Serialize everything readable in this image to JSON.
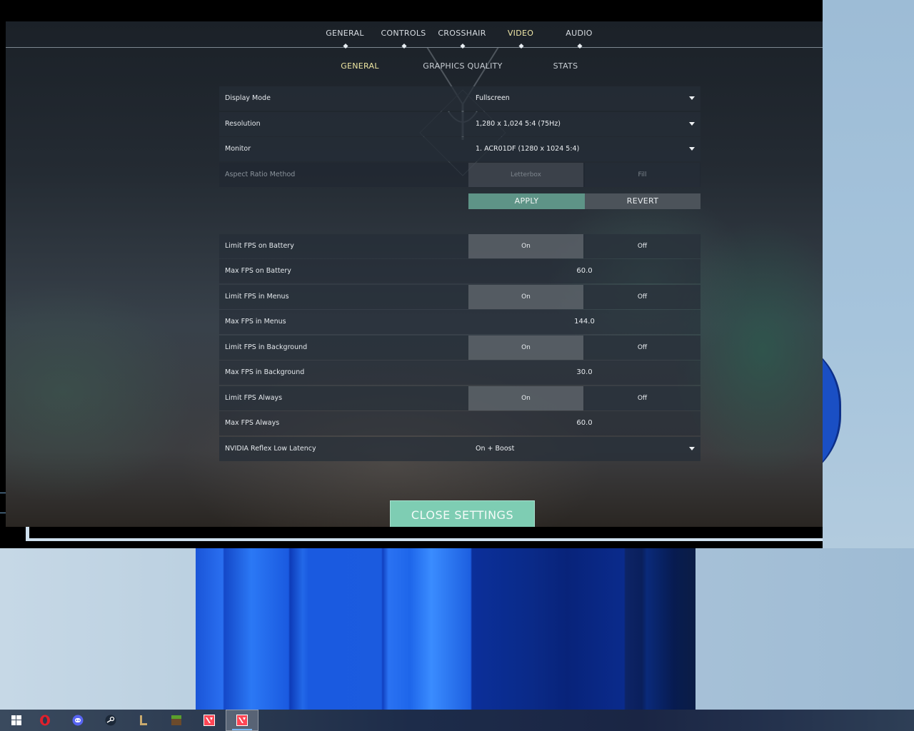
{
  "nav": {
    "tabs": [
      "GENERAL",
      "CONTROLS",
      "CROSSHAIR",
      "VIDEO",
      "AUDIO"
    ],
    "active_tab": "VIDEO",
    "subtabs": [
      "GENERAL",
      "GRAPHICS QUALITY",
      "STATS"
    ],
    "active_subtab": "GENERAL"
  },
  "display": {
    "display_mode": {
      "label": "Display Mode",
      "value": "Fullscreen"
    },
    "resolution": {
      "label": "Resolution",
      "value": "1,280 x 1,024 5:4 (75Hz)"
    },
    "monitor": {
      "label": "Monitor",
      "value": "1. ACR01DF (1280 x  1024 5:4)"
    },
    "aspect_ratio": {
      "label": "Aspect Ratio Method",
      "option1": "Letterbox",
      "option2": "Fill"
    }
  },
  "buttons": {
    "apply": "APPLY",
    "revert": "REVERT",
    "close": "CLOSE SETTINGS"
  },
  "fps": {
    "limit_battery": {
      "label": "Limit FPS on Battery",
      "on": "On",
      "off": "Off",
      "selected": "On"
    },
    "max_battery": {
      "label": "Max FPS on Battery",
      "value": "60.0"
    },
    "limit_menus": {
      "label": "Limit FPS in Menus",
      "on": "On",
      "off": "Off",
      "selected": "On"
    },
    "max_menus": {
      "label": "Max FPS in Menus",
      "value": "144.0"
    },
    "limit_background": {
      "label": "Limit FPS in Background",
      "on": "On",
      "off": "Off",
      "selected": "On"
    },
    "max_background": {
      "label": "Max FPS in Background",
      "value": "30.0"
    },
    "limit_always": {
      "label": "Limit FPS Always",
      "on": "On",
      "off": "Off",
      "selected": "On"
    },
    "max_always": {
      "label": "Max FPS Always",
      "value": "60.0"
    },
    "nvidia_reflex": {
      "label": "NVIDIA Reflex Low Latency",
      "value": "On + Boost"
    }
  },
  "taskbar": {
    "icons": [
      "windows-start-icon",
      "opera-icon",
      "discord-icon",
      "steam-icon",
      "league-of-legends-icon",
      "minecraft-icon",
      "valorant-icon",
      "valorant-active-icon"
    ]
  },
  "colors": {
    "accent_teal": "#7ecdb3",
    "apply_green": "#5e9487",
    "active_tab_yellow": "#f0e8a8"
  }
}
